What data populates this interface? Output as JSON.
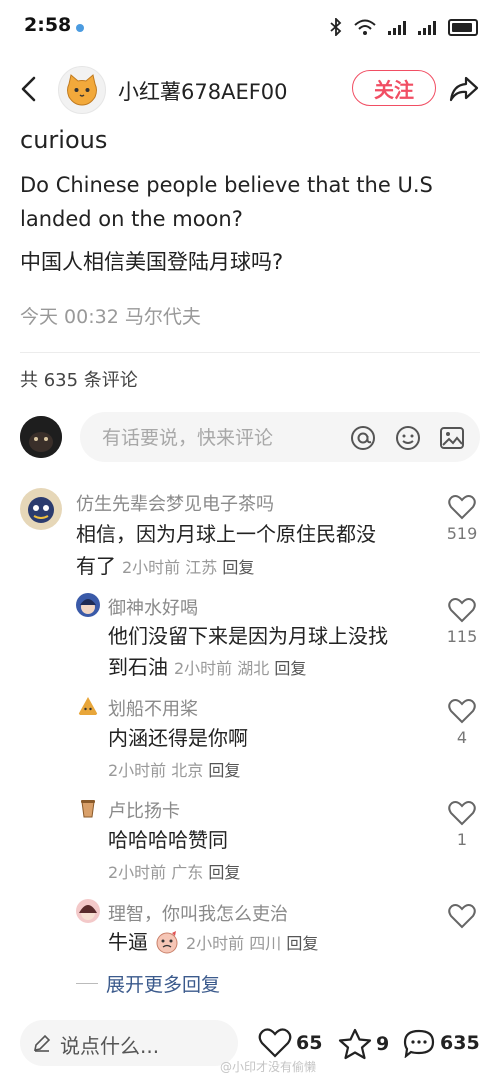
{
  "status_bar": {
    "time": "2:58"
  },
  "header": {
    "author_name": "小红薯678AEF00",
    "follow_label": "关注"
  },
  "post": {
    "title": "curious",
    "body_en": "Do Chinese people believe that the U.S landed on the moon?",
    "body_zh": "中国人相信美国登陆月球吗?",
    "meta": "今天 00:32 马尔代夫"
  },
  "comments_section": {
    "count_label": "共 635 条评论",
    "input_placeholder": "有话要说，快来评论"
  },
  "comments": [
    {
      "name": "仿生先辈会梦见电子茶吗",
      "text": "相信，因为月球上一个原住民都没有了",
      "line1": "相信，因为月球上一个原住民都没",
      "line2": "有了",
      "time": "2小时前",
      "location": "江苏",
      "reply": "回复",
      "likes": "519"
    },
    {
      "name": "御神水好喝",
      "line1": "他们没留下来是因为月球上没找",
      "line2": "到石油",
      "time": "2小时前",
      "location": "湖北",
      "reply": "回复",
      "likes": "115"
    },
    {
      "name": "划船不用桨",
      "line1": "内涵还得是你啊",
      "time": "2小时前",
      "location": "北京",
      "reply": "回复",
      "likes": "4"
    },
    {
      "name": "卢比扬卡",
      "line1": "哈哈哈哈赞同",
      "time": "2小时前",
      "location": "广东",
      "reply": "回复",
      "likes": "1"
    },
    {
      "name": "理智，你叫我怎么吏治",
      "line1": "牛逼",
      "time": "2小时前",
      "location": "四川",
      "reply": "回复",
      "likes": ""
    }
  ],
  "expand_label": "展开更多回复",
  "bottom_bar": {
    "input_label": "说点什么...",
    "likes": "65",
    "stars": "9",
    "comments": "635"
  },
  "watermark": "@小印才没有偷懒"
}
